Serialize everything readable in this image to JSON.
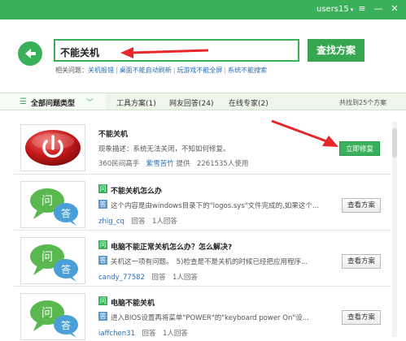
{
  "window": {
    "user": "users15",
    "user_caret": "▾",
    "menu_icon": "≡",
    "minimize_icon": "—",
    "close_icon": "✕"
  },
  "search": {
    "value": "不能关机",
    "button": "查找方案",
    "related_label": "相关问题：",
    "related": [
      "关机报错",
      "桌面不能自动刷新",
      "玩游戏不能全屏",
      "系统不能搜索"
    ]
  },
  "tabs": {
    "all_icon": "☰",
    "all": "全部问题类型",
    "all_chevron": "﹀",
    "items": [
      "工具方案(1)",
      "网友回答(24)",
      "在线专家(2)"
    ],
    "found": "共找到25个方案"
  },
  "results": [
    {
      "title": "不能关机",
      "desc": "现象描述：系统无法关闭，不知如何修复。",
      "meta_prefix": "360民间高手",
      "author": "紫雪苦竹",
      "meta_suffix": "提供　2261535人使用",
      "button": "立即修复"
    },
    {
      "q_tag": "问",
      "a_tag": "答",
      "title": "不能关机怎么办",
      "desc": "这个内容是由windows目录下的\"logos.sys\"文件完成的,如果这个...",
      "author": "zhig_cq",
      "meta_suffix": "回答　1人回答",
      "button": "查看方案"
    },
    {
      "q_tag": "问",
      "a_tag": "答",
      "title": "电脑不能正常关机怎么办？怎么解决?",
      "desc": "关机这一项有问题。　5)检查是不是关机的时候已经把应用程序...",
      "author": "candy_77582",
      "meta_suffix": "回答　1人回答",
      "button": "查看方案"
    },
    {
      "q_tag": "问",
      "a_tag": "答",
      "title": "电脑不能关机",
      "desc": "进入BIOS设置再将菜单\"POWER\"的\"keyboard power On\"设...",
      "author": "iaffchen31",
      "meta_suffix": "回答　1人回答",
      "button": "查看方案"
    }
  ],
  "colors": {
    "brand_green": "#3bb05b",
    "annotation_red": "#e8262b",
    "link_blue": "#2a6fb5"
  }
}
